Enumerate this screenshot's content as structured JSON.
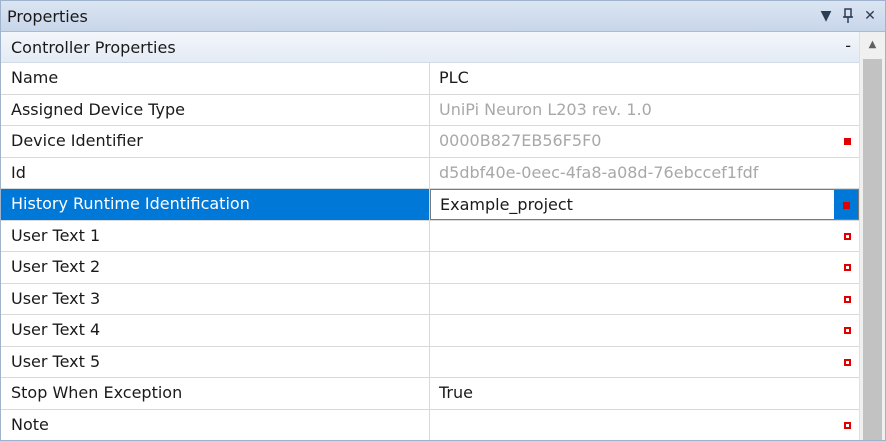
{
  "panel": {
    "title": "Properties",
    "dropdown_icon": "▼",
    "pin_icon": "📌",
    "close_icon": "✕"
  },
  "category": {
    "label": "Controller Properties",
    "toggle": "-"
  },
  "rows": [
    {
      "name": "Name",
      "value": "PLC",
      "readonly": false,
      "marker": "none"
    },
    {
      "name": "Assigned Device Type",
      "value": "UniPi Neuron L203 rev. 1.0",
      "readonly": true,
      "marker": "none"
    },
    {
      "name": "Device Identifier",
      "value": "0000B827EB56F5F0",
      "readonly": true,
      "marker": "filled"
    },
    {
      "name": "Id",
      "value": "d5dbf40e-0eec-4fa8-a08d-76ebccef1fdf",
      "readonly": true,
      "marker": "none"
    },
    {
      "name": "History Runtime Identification",
      "value": "Example_project",
      "readonly": false,
      "marker": "filled",
      "selected": true
    },
    {
      "name": "User Text 1",
      "value": "",
      "readonly": false,
      "marker": "hollow"
    },
    {
      "name": "User Text 2",
      "value": "",
      "readonly": false,
      "marker": "hollow"
    },
    {
      "name": "User Text 3",
      "value": "",
      "readonly": false,
      "marker": "hollow"
    },
    {
      "name": "User Text 4",
      "value": "",
      "readonly": false,
      "marker": "hollow"
    },
    {
      "name": "User Text 5",
      "value": "",
      "readonly": false,
      "marker": "hollow"
    },
    {
      "name": "Stop When Exception",
      "value": "True",
      "readonly": false,
      "marker": "none"
    },
    {
      "name": "Note",
      "value": "",
      "readonly": false,
      "marker": "hollow"
    }
  ],
  "colors": {
    "selection": "#0078d7",
    "marker": "#e00000",
    "readonly_text": "#a8a8a8"
  },
  "scrollbar": {
    "up_arrow": "▲"
  }
}
